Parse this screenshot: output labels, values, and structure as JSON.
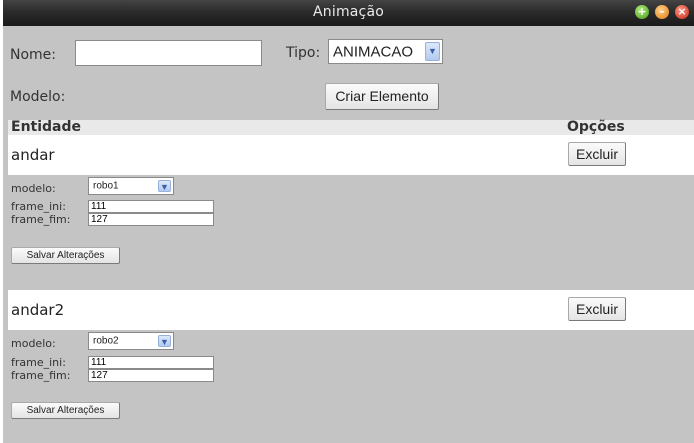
{
  "window": {
    "title": "Animação"
  },
  "form": {
    "nome_label": "Nome:",
    "nome_value": "",
    "tipo_label": "Tipo:",
    "tipo_value": "ANIMACAO",
    "modelo_label": "Modelo:",
    "criar_button": "Criar Elemento"
  },
  "table": {
    "col_entidade": "Entidade",
    "col_opcoes": "Opções"
  },
  "entities": [
    {
      "name": "andar",
      "delete_label": "Excluir",
      "modelo_label": "modelo:",
      "modelo_value": "robo1",
      "frame_ini_label": "frame_ini:",
      "frame_ini_value": "111",
      "frame_fim_label": "frame_fim:",
      "frame_fim_value": "127",
      "save_label": "Salvar Alterações"
    },
    {
      "name": "andar2",
      "delete_label": "Excluir",
      "modelo_label": "modelo:",
      "modelo_value": "robo2",
      "frame_ini_label": "frame_ini:",
      "frame_ini_value": "111",
      "frame_fim_label": "frame_fim:",
      "frame_fim_value": "127",
      "save_label": "Salvar Alterações"
    }
  ]
}
